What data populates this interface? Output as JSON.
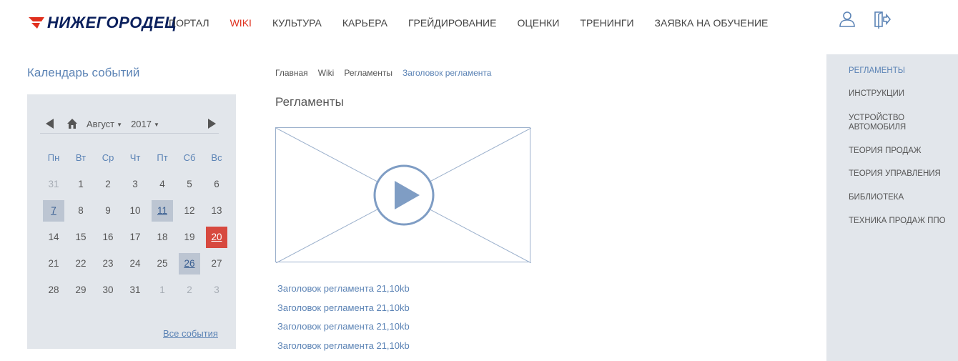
{
  "header": {
    "logo_text": "НИЖЕГОРОДЕЦ",
    "nav": [
      "ПОРТАЛ",
      "WIKI",
      "КУЛЬТУРА",
      "КАРЬЕРА",
      "ГРЕЙДИРОВАНИЕ",
      "ОЦЕНКИ",
      "ТРЕНИНГИ",
      "ЗАЯВКА НА ОБУЧЕНИЕ"
    ],
    "active_nav": "WIKI",
    "icons": [
      "user-icon",
      "logout-icon"
    ]
  },
  "calendar": {
    "title": "Календарь событий",
    "month": "Август",
    "year": "2017",
    "weekdays": [
      "Пн",
      "Вт",
      "Ср",
      "Чт",
      "Пт",
      "Сб",
      "Вс"
    ],
    "weeks": [
      [
        "31",
        "1",
        "2",
        "3",
        "4",
        "5",
        "6"
      ],
      [
        "7",
        "8",
        "9",
        "10",
        "11",
        "12",
        "13"
      ],
      [
        "14",
        "15",
        "16",
        "17",
        "18",
        "19",
        "20"
      ],
      [
        "21",
        "22",
        "23",
        "24",
        "25",
        "26",
        "27"
      ],
      [
        "28",
        "29",
        "30",
        "31",
        "1",
        "2",
        "3"
      ]
    ],
    "event_days": [
      "7",
      "11",
      "26"
    ],
    "today": "20",
    "all_events": "Все события"
  },
  "main": {
    "breadcrumbs": [
      "Главная",
      "Wiki",
      "Регламенты",
      "Заголовок регламента"
    ],
    "title": "Регламенты",
    "documents": [
      "Заголовок регламента 21,10kb",
      "Заголовок регламента 21,10kb",
      "Заголовок регламента 21,10kb",
      "Заголовок регламента 21,10kb"
    ]
  },
  "sidebar": {
    "items": [
      "РЕГЛАМЕНТЫ",
      "ИНСТРУКЦИИ",
      "УСТРОЙСТВО АВТОМОБИЛЯ",
      "ТЕОРИЯ ПРОДАЖ",
      "ТЕОРИЯ УПРАВЛЕНИЯ",
      "БИБЛИОТЕКА",
      "ТЕХНИКА ПРОДАЖ ППО"
    ],
    "active": "РЕГЛАМЕНТЫ"
  },
  "colors": {
    "accent": "#5b83b5",
    "active_nav": "#e0301e",
    "today": "#d7493f",
    "panel": "#e2e6eb"
  }
}
